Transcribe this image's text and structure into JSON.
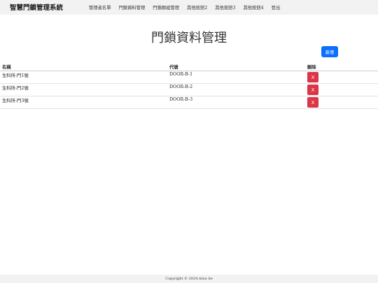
{
  "navbar": {
    "brand": "智慧門鎖管理系統",
    "links": [
      "管理者名單",
      "門鎖資料管理",
      "門鎖群組管理",
      "其他按鈕2",
      "其他按鈕3",
      "其他按鈕4",
      "登出"
    ]
  },
  "main": {
    "title": "門鎖資料管理",
    "add_label": "新增",
    "table": {
      "headers": [
        "名稱",
        "代號",
        "刪除"
      ],
      "rows": [
        {
          "name": "生科所-門1號",
          "code": "DOOR-B-1",
          "delete_label": "X"
        },
        {
          "name": "生科所-門2號",
          "code": "DOOR-B-2",
          "delete_label": "X"
        },
        {
          "name": "生科所-門3號",
          "code": "DOOR-B-3",
          "delete_label": "X"
        }
      ]
    }
  },
  "footer": {
    "copyright": "Copyright © 2024 ntnu ite"
  },
  "colors": {
    "primary": "#0d6efd",
    "danger": "#dc3545",
    "navbar_bg": "#f2f2f2"
  }
}
